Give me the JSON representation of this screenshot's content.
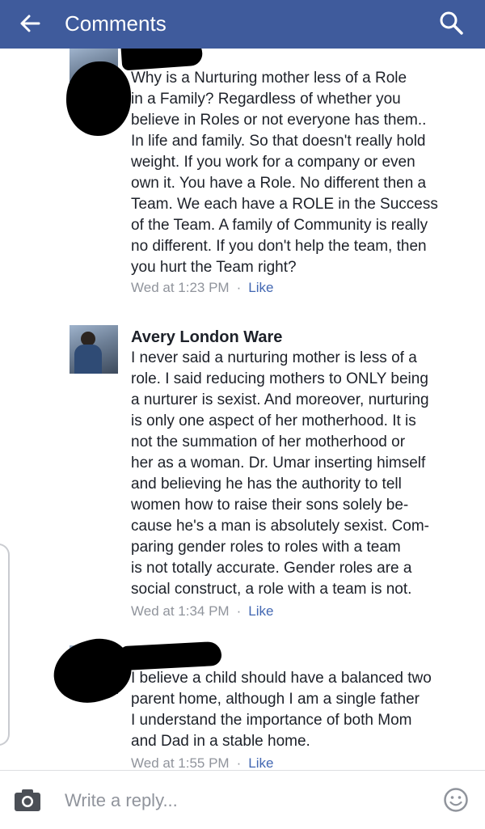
{
  "header": {
    "title": "Comments"
  },
  "comments": [
    {
      "author": "",
      "text": "Why is a Nurturing mother less of a Role\nin a Family? Regardless of whether you\nbelieve in Roles or not everyone has them..\nIn life and family. So that doesn't really hold\nweight. If you work for a company or even\nown it. You have a Role. No different then a\nTeam. We each have a ROLE in the Success\nof the Team. A family of Community is really\nno different. If you don't help the team, then\nyou hurt the Team right?",
      "time": "Wed at 1:23 PM",
      "separator": "·",
      "like_label": "Like"
    },
    {
      "author": "Avery London Ware",
      "text": "I never said a nurturing mother is less of a\nrole. I said reducing mothers to ONLY being\na nurturer is sexist. And moreover, nurturing\nis only one aspect of her motherhood. It is\nnot the summation of her motherhood or\nher as a woman. Dr. Umar inserting himself\nand believing he has the authority to tell\nwomen how to raise their sons solely be-\ncause he's a man is absolutely sexist. Com-\nparing gender roles to roles with a team\nis not totally accurate. Gender roles are a\nsocial construct, a role with a team is not.",
      "time": "Wed at 1:34 PM",
      "separator": "·",
      "like_label": "Like"
    },
    {
      "author": "",
      "text": "I believe a child should have a balanced two\nparent home, although I am a single father\nI understand the importance of both Mom\nand Dad in a stable home.",
      "time": "Wed at 1:55 PM",
      "separator": "·",
      "like_label": "Like"
    }
  ],
  "composer": {
    "placeholder": "Write a reply..."
  },
  "colors": {
    "header_bg": "#3f5b9c",
    "link": "#4267b2",
    "meta": "#90949c",
    "text": "#1d2129"
  },
  "icons": [
    "back-arrow-icon",
    "search-icon",
    "camera-icon",
    "emoji-icon"
  ]
}
